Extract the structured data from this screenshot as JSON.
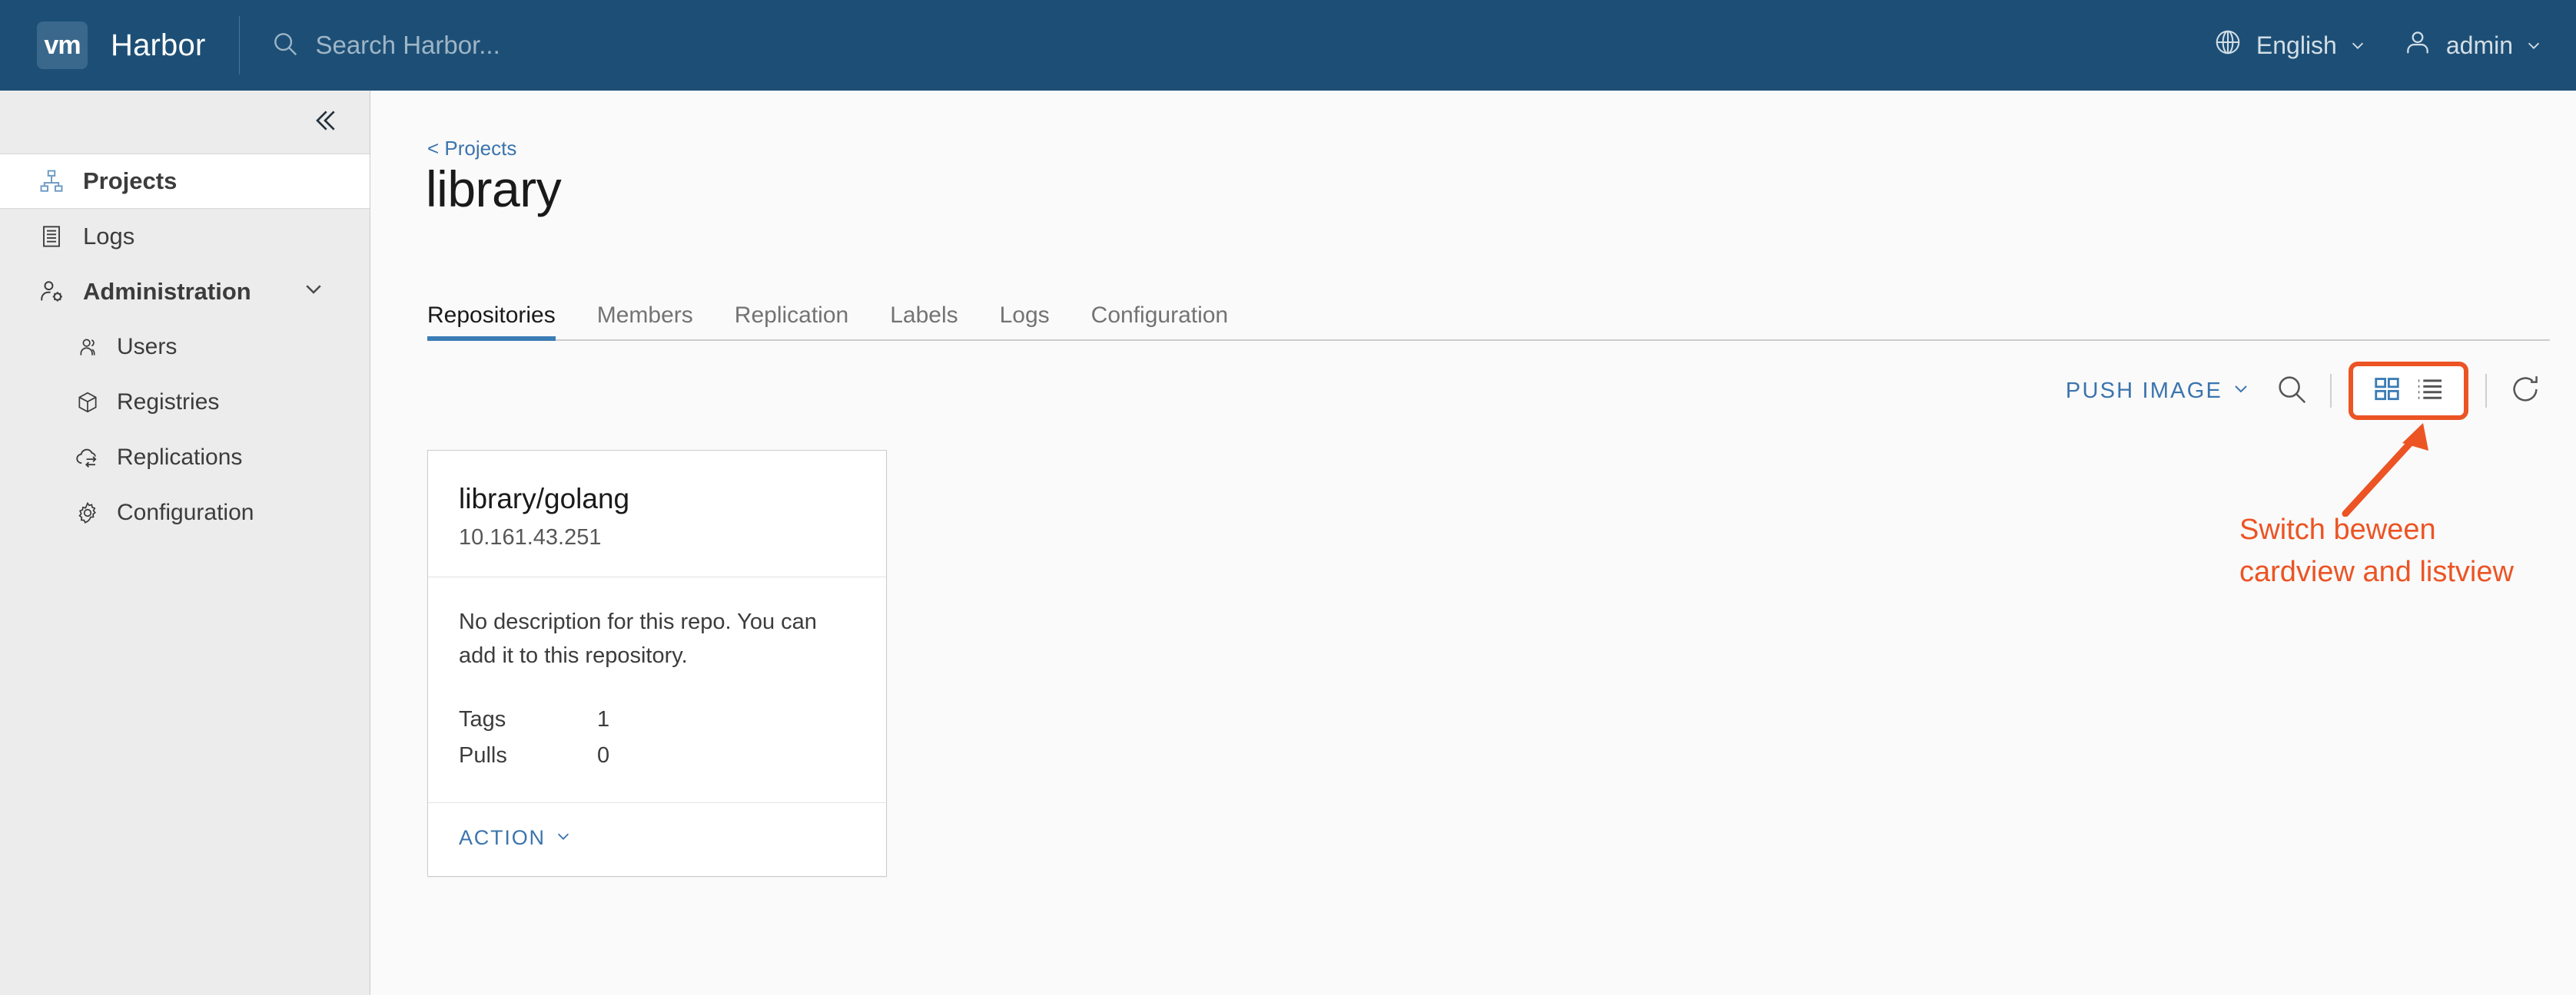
{
  "header": {
    "logo_text": "vm",
    "brand_title": "Harbor",
    "search_placeholder": "Search Harbor...",
    "search_value": "",
    "language_label": "English",
    "user_label": "admin",
    "background_color": "#1d4f76"
  },
  "sidebar": {
    "collapse_icon": "double-chevron-left-icon",
    "items": [
      {
        "label": "Projects",
        "icon": "projects-icon",
        "active": true
      },
      {
        "label": "Logs",
        "icon": "logs-icon",
        "active": false
      },
      {
        "label": "Administration",
        "icon": "administration-icon",
        "active": false,
        "expanded": true
      }
    ],
    "sub_items": [
      {
        "label": "Users",
        "icon": "users-icon"
      },
      {
        "label": "Registries",
        "icon": "registries-icon"
      },
      {
        "label": "Replications",
        "icon": "replications-icon"
      },
      {
        "label": "Configuration",
        "icon": "configuration-icon"
      }
    ]
  },
  "main": {
    "breadcrumb": "< Projects",
    "page_title": "library",
    "tabs": [
      {
        "label": "Repositories",
        "active": true
      },
      {
        "label": "Members",
        "active": false
      },
      {
        "label": "Replication",
        "active": false
      },
      {
        "label": "Labels",
        "active": false
      },
      {
        "label": "Logs",
        "active": false
      },
      {
        "label": "Configuration",
        "active": false
      }
    ],
    "toolbar": {
      "push_image_label": "PUSH IMAGE",
      "search_icon": "search-icon",
      "card_view_icon": "grid-view-icon",
      "list_view_icon": "list-view-icon",
      "refresh_icon": "refresh-icon",
      "active_view": "card",
      "highlight_color": "#ec5424",
      "accent_color": "#3b74ad"
    },
    "repository_card": {
      "title": "library/golang",
      "registry_host": "10.161.43.251",
      "description": "No description for this repo. You can add it to this repository.",
      "stats": [
        {
          "label": "Tags",
          "value": "1"
        },
        {
          "label": "Pulls",
          "value": "0"
        }
      ],
      "action_label": "ACTION"
    },
    "annotation": {
      "text": "Switch beween cardview and listview",
      "color": "#ec5424"
    }
  }
}
